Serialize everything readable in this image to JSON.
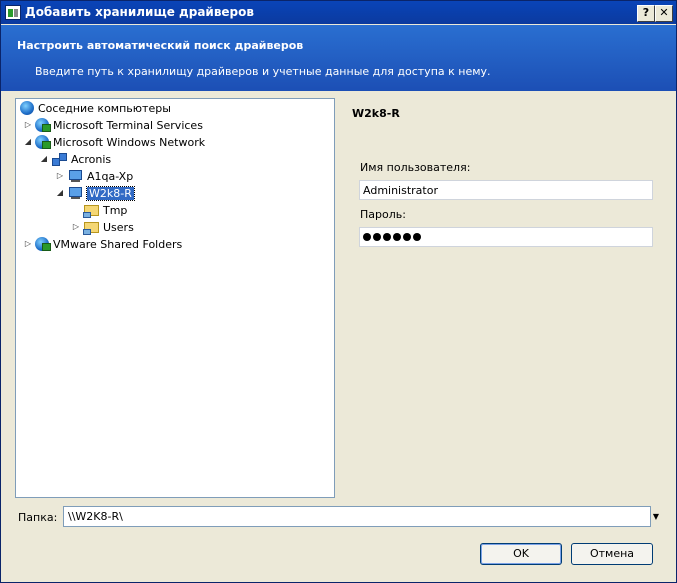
{
  "window": {
    "title": "Добавить хранилище драйверов",
    "help_glyph": "?",
    "close_glyph": "✕"
  },
  "header": {
    "title": "Настроить автоматический поиск драйверов",
    "subtitle": "Введите путь к хранилищу драйверов и учетные данные для доступа к нему."
  },
  "tree": {
    "root": "Соседние компьютеры",
    "mts": "Microsoft Terminal Services",
    "mwn": "Microsoft Windows Network",
    "acronis": "Acronis",
    "a1qa": "A1qa-Xp",
    "w2k8": "W2k8-R",
    "tmp": "Tmp",
    "users": "Users",
    "vmware": "VMware Shared Folders"
  },
  "details": {
    "server_name": "W2k8-R",
    "username_label": "Имя пользователя:",
    "username_value": "Administrator",
    "password_label": "Пароль:",
    "password_mask_count": 6
  },
  "folder": {
    "label": "Папка:",
    "value": "\\\\W2K8-R\\"
  },
  "buttons": {
    "ok": "OK",
    "cancel": "Отмена"
  },
  "colors": {
    "title_bar": "#0b3a9f",
    "banner": "#2a6fd1",
    "selection": "#316ac5"
  }
}
